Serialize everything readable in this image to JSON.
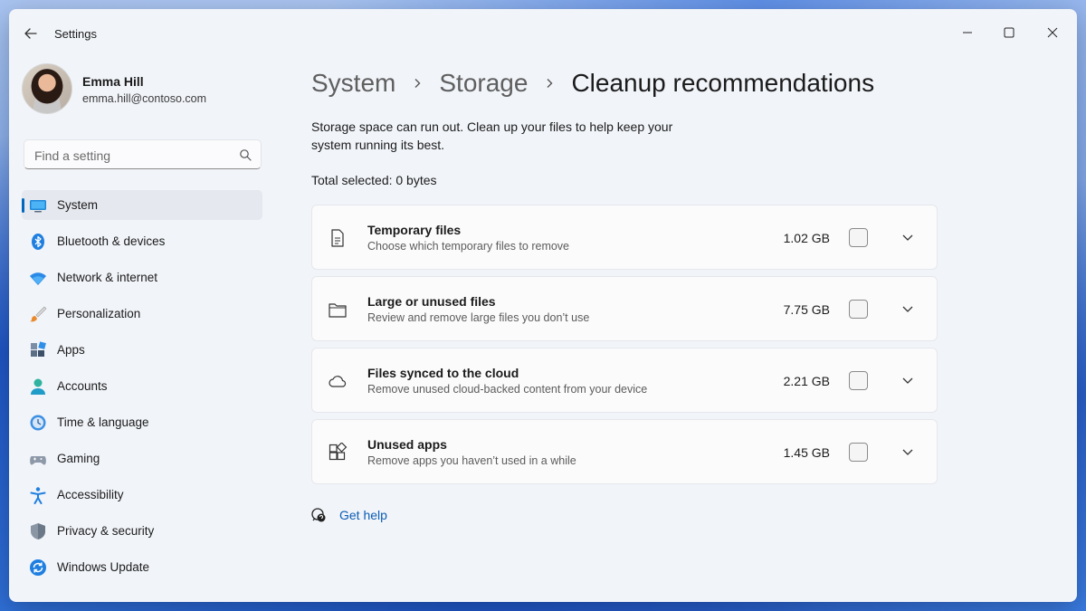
{
  "window": {
    "title": "Settings"
  },
  "profile": {
    "name": "Emma Hill",
    "email": "emma.hill@contoso.com"
  },
  "search": {
    "placeholder": "Find a setting"
  },
  "nav": {
    "items": [
      {
        "label": "System",
        "icon": "system-icon",
        "active": true
      },
      {
        "label": "Bluetooth & devices",
        "icon": "bluetooth-icon"
      },
      {
        "label": "Network & internet",
        "icon": "wifi-icon"
      },
      {
        "label": "Personalization",
        "icon": "brush-icon"
      },
      {
        "label": "Apps",
        "icon": "apps-icon"
      },
      {
        "label": "Accounts",
        "icon": "accounts-icon"
      },
      {
        "label": "Time & language",
        "icon": "globe-clock-icon"
      },
      {
        "label": "Gaming",
        "icon": "gamepad-icon"
      },
      {
        "label": "Accessibility",
        "icon": "accessibility-icon"
      },
      {
        "label": "Privacy & security",
        "icon": "shield-icon"
      },
      {
        "label": "Windows Update",
        "icon": "update-icon"
      }
    ]
  },
  "breadcrumb": {
    "items": [
      "System",
      "Storage"
    ],
    "current": "Cleanup recommendations"
  },
  "main": {
    "description": "Storage space can run out. Clean up your files to help keep your system running its best.",
    "total_selected": "Total selected: 0 bytes",
    "cards": [
      {
        "title": "Temporary files",
        "subtitle": "Choose which temporary files to remove",
        "size": "1.02 GB",
        "checked": false,
        "icon": "document-icon"
      },
      {
        "title": "Large or unused files",
        "subtitle": "Review and remove large files you don’t use",
        "size": "7.75 GB",
        "checked": false,
        "icon": "folder-icon"
      },
      {
        "title": "Files synced to the cloud",
        "subtitle": "Remove unused cloud-backed content from your device",
        "size": "2.21 GB",
        "checked": false,
        "icon": "cloud-icon"
      },
      {
        "title": "Unused apps",
        "subtitle": "Remove apps you haven’t used in a while",
        "size": "1.45 GB",
        "checked": false,
        "icon": "apps-grid-icon"
      }
    ],
    "help_label": "Get help"
  },
  "colors": {
    "accent": "#0067c0",
    "window_bg": "#f1f4f9",
    "card_bg": "#fbfbfc",
    "link": "#0a5cb5"
  }
}
